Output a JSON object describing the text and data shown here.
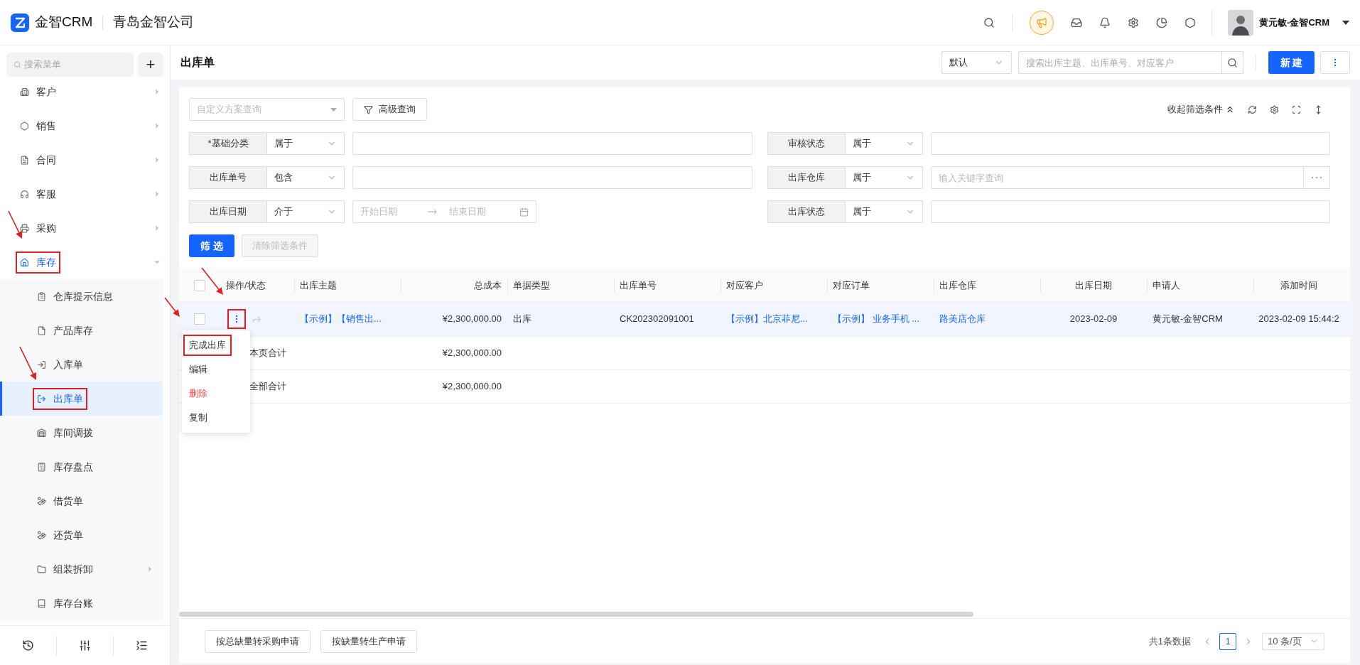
{
  "app": {
    "logo_text": "金智CRM",
    "company": "青岛金智公司",
    "user": "黄元敏-金智CRM"
  },
  "sidebar": {
    "search_placeholder": "搜索菜单",
    "add": "+",
    "items": [
      {
        "label": "客户",
        "kind": "group",
        "expanded": false,
        "selected": false,
        "annotated": false
      },
      {
        "label": "销售",
        "kind": "group",
        "expanded": false,
        "selected": false,
        "annotated": false
      },
      {
        "label": "合同",
        "kind": "group",
        "expanded": false,
        "selected": false,
        "annotated": false
      },
      {
        "label": "客服",
        "kind": "group",
        "expanded": false,
        "selected": false,
        "annotated": false
      },
      {
        "label": "采购",
        "kind": "group",
        "expanded": false,
        "selected": false,
        "annotated": false
      },
      {
        "label": "库存",
        "kind": "group",
        "expanded": true,
        "selected": false,
        "annotated": true,
        "children": [
          {
            "label": "仓库提示信息",
            "kind": "page",
            "selected": false,
            "annotated": false
          },
          {
            "label": "产品库存",
            "kind": "page",
            "selected": false,
            "annotated": false
          },
          {
            "label": "入库单",
            "kind": "page",
            "selected": false,
            "annotated": false
          },
          {
            "label": "出库单",
            "kind": "page",
            "selected": true,
            "annotated": true
          },
          {
            "label": "库间调拨",
            "kind": "page",
            "selected": false,
            "annotated": false
          },
          {
            "label": "库存盘点",
            "kind": "page",
            "selected": false,
            "annotated": false
          },
          {
            "label": "借货单",
            "kind": "page",
            "selected": false,
            "annotated": false
          },
          {
            "label": "还货单",
            "kind": "page",
            "selected": false,
            "annotated": false
          },
          {
            "label": "组装拆卸",
            "kind": "group",
            "expanded": false,
            "selected": false,
            "annotated": false
          },
          {
            "label": "库存台账",
            "kind": "page",
            "selected": false,
            "annotated": false
          }
        ]
      }
    ]
  },
  "page": {
    "title": "出库单",
    "view": "默认",
    "search_placeholder": "搜索出库主题、出库单号、对应客户",
    "new_button": "新 建"
  },
  "filter": {
    "scheme_placeholder": "自定义方案查询",
    "advanced": "高级查询",
    "collapse": "收起筛选条件",
    "conditions": [
      {
        "label": "*基础分类",
        "operator": "属于",
        "kind": "text"
      },
      {
        "label": "审核状态",
        "operator": "属于",
        "kind": "text"
      },
      {
        "label": "出库单号",
        "operator": "包含",
        "kind": "text"
      },
      {
        "label": "出库仓库",
        "operator": "属于",
        "kind": "picker",
        "placeholder": "输入关键字查询"
      },
      {
        "label": "出库日期",
        "operator": "介于",
        "kind": "date",
        "start_placeholder": "开始日期",
        "end_placeholder": "结束日期"
      },
      {
        "label": "出库状态",
        "operator": "属于",
        "kind": "text"
      }
    ],
    "apply": "筛 选",
    "clear": {
      "label": "清除筛选条件",
      "disabled": true
    }
  },
  "table": {
    "columns": [
      {
        "label": "操作/状态",
        "kind": "text"
      },
      {
        "label": "出库主题",
        "kind": "text"
      },
      {
        "label": "总成本",
        "kind": "money"
      },
      {
        "label": "单据类型",
        "kind": "text"
      },
      {
        "label": "出库单号",
        "kind": "text"
      },
      {
        "label": "对应客户",
        "kind": "text"
      },
      {
        "label": "对应订单",
        "kind": "text"
      },
      {
        "label": "出库仓库",
        "kind": "text"
      },
      {
        "label": "出库日期",
        "kind": "date"
      },
      {
        "label": "申请人",
        "kind": "text"
      },
      {
        "label": "添加时间",
        "kind": "date"
      }
    ],
    "header_checked": false,
    "rows": [
      {
        "checked": false,
        "selected": true,
        "annotated": true,
        "cells": [
          {
            "text": "",
            "kind": "actions"
          },
          {
            "text": "【示例】【销售出...",
            "kind": "link"
          },
          {
            "text": "¥2,300,000.00",
            "kind": "text"
          },
          {
            "text": "出库",
            "kind": "text"
          },
          {
            "text": "CK202302091001",
            "kind": "text"
          },
          {
            "text": "【示例】北京菲尼...",
            "kind": "link"
          },
          {
            "text": "【示例】 业务手机 ...",
            "kind": "link"
          },
          {
            "text": "路美店仓库",
            "kind": "link"
          },
          {
            "text": "2023-02-09",
            "kind": "text"
          },
          {
            "text": "黄元敏-金智CRM",
            "kind": "text"
          },
          {
            "text": "2023-02-09 15:44:2",
            "kind": "text"
          }
        ]
      }
    ],
    "summary": [
      {
        "label": "本页合计",
        "total": "¥2,300,000.00"
      },
      {
        "label": "全部合计",
        "total": "¥2,300,000.00"
      }
    ]
  },
  "row_menu": [
    {
      "label": "完成出库",
      "danger": false,
      "annotated": true
    },
    {
      "label": "编辑",
      "danger": false,
      "annotated": false
    },
    {
      "label": "删除",
      "danger": true,
      "annotated": false
    },
    {
      "label": "复制",
      "danger": false,
      "annotated": false
    }
  ],
  "footer": {
    "buttons": [
      "按总缺量转采购申请",
      "按缺量转生产申请"
    ],
    "total": "共1条数据",
    "pages": [
      {
        "label": "1",
        "selected": true
      }
    ],
    "page_size": "10 条/页"
  }
}
